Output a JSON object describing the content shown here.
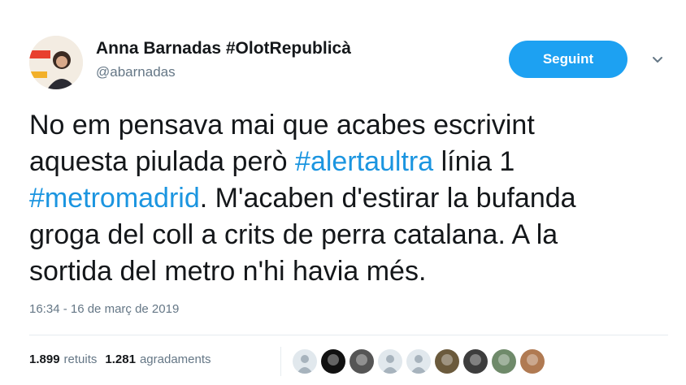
{
  "user": {
    "display_name": "Anna Barnadas #OlotRepublicà",
    "handle": "@abarnadas",
    "avatar_icon": "profile-photo"
  },
  "follow_button": {
    "label": "Seguint"
  },
  "menu": {
    "icon": "chevron-down-icon"
  },
  "tweet": {
    "lines": [
      [
        {
          "text": "No em pensava mai que acabes escrivint",
          "link": false
        }
      ],
      [
        {
          "text": "aquesta piulada però ",
          "link": false
        },
        {
          "text": "#alertaultra",
          "link": true
        },
        {
          "text": " línia 1",
          "link": false
        }
      ],
      [
        {
          "text": "#metromadrid",
          "link": true
        },
        {
          "text": ". M'acaben d'estirar la bufanda",
          "link": false
        }
      ],
      [
        {
          "text": "groga del coll a crits de perra catalana. A la",
          "link": false
        }
      ],
      [
        {
          "text": "sortida del metro n'hi havia més.",
          "link": false
        }
      ]
    ],
    "timestamp": "16:34 - 16 de març de 2019"
  },
  "stats": {
    "retweets_count": "1.899",
    "retweets_label": "retuits",
    "likes_count": "1.281",
    "likes_label": "agradaments"
  },
  "likers": [
    {
      "icon": "default-avatar-icon",
      "color": "#a7b3bd"
    },
    {
      "icon": "dark-planet-avatar-icon",
      "color": "#111111"
    },
    {
      "icon": "helmet-avatar-icon",
      "color": "#555555"
    },
    {
      "icon": "default-avatar-icon",
      "color": "#a7b3bd"
    },
    {
      "icon": "default-avatar-icon",
      "color": "#a7b3bd"
    },
    {
      "icon": "cartoon-avatar-icon",
      "color": "#6b5a3c"
    },
    {
      "icon": "dog-avatar-icon",
      "color": "#3d3d3d"
    },
    {
      "icon": "landscape-avatar-icon",
      "color": "#6f8a6a"
    },
    {
      "icon": "portrait-avatar-icon",
      "color": "#b07a52"
    }
  ],
  "colors": {
    "accent": "#1da1f2",
    "hashtag": "#1b95e0",
    "muted": "#657786",
    "text": "#14171a"
  }
}
